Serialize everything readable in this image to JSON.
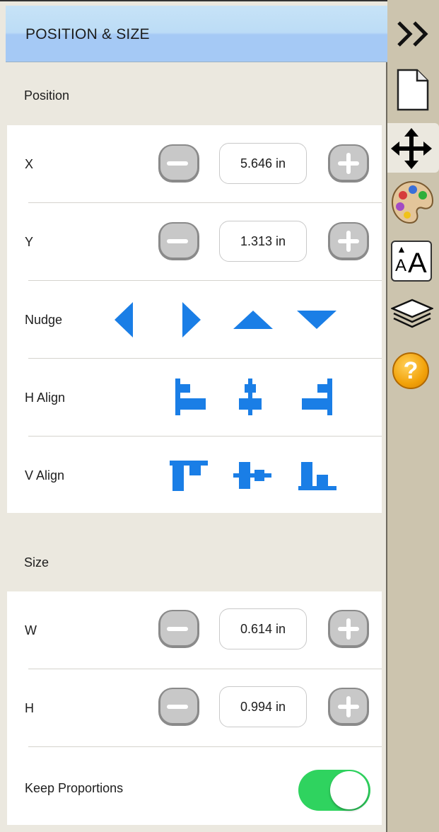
{
  "header": {
    "title": "POSITION & SIZE"
  },
  "position": {
    "label": "Position",
    "x": {
      "label": "X",
      "value": "5.646 in"
    },
    "y": {
      "label": "Y",
      "value": "1.313 in"
    },
    "nudge": {
      "label": "Nudge"
    },
    "h_align": {
      "label": "H Align"
    },
    "v_align": {
      "label": "V Align"
    }
  },
  "size": {
    "label": "Size",
    "w": {
      "label": "W",
      "value": "0.614 in"
    },
    "h": {
      "label": "H",
      "value": "0.994 in"
    },
    "keep_proportions": {
      "label": "Keep Proportions",
      "on": true
    }
  },
  "sidebar": {
    "tabs": [
      {
        "icon": "collapse-chevrons-icon"
      },
      {
        "icon": "document-icon"
      },
      {
        "icon": "move-arrows-icon",
        "active": true
      },
      {
        "icon": "palette-icon"
      },
      {
        "icon": "font-size-icon",
        "text": "A"
      },
      {
        "icon": "layers-icon"
      },
      {
        "icon": "help-icon",
        "text": "?"
      }
    ]
  },
  "colors": {
    "accent": "#1a7ee6",
    "toggle_on": "#2fd35f",
    "header_blue": "#a5c9f5",
    "sidebar": "#ccc4ae"
  }
}
